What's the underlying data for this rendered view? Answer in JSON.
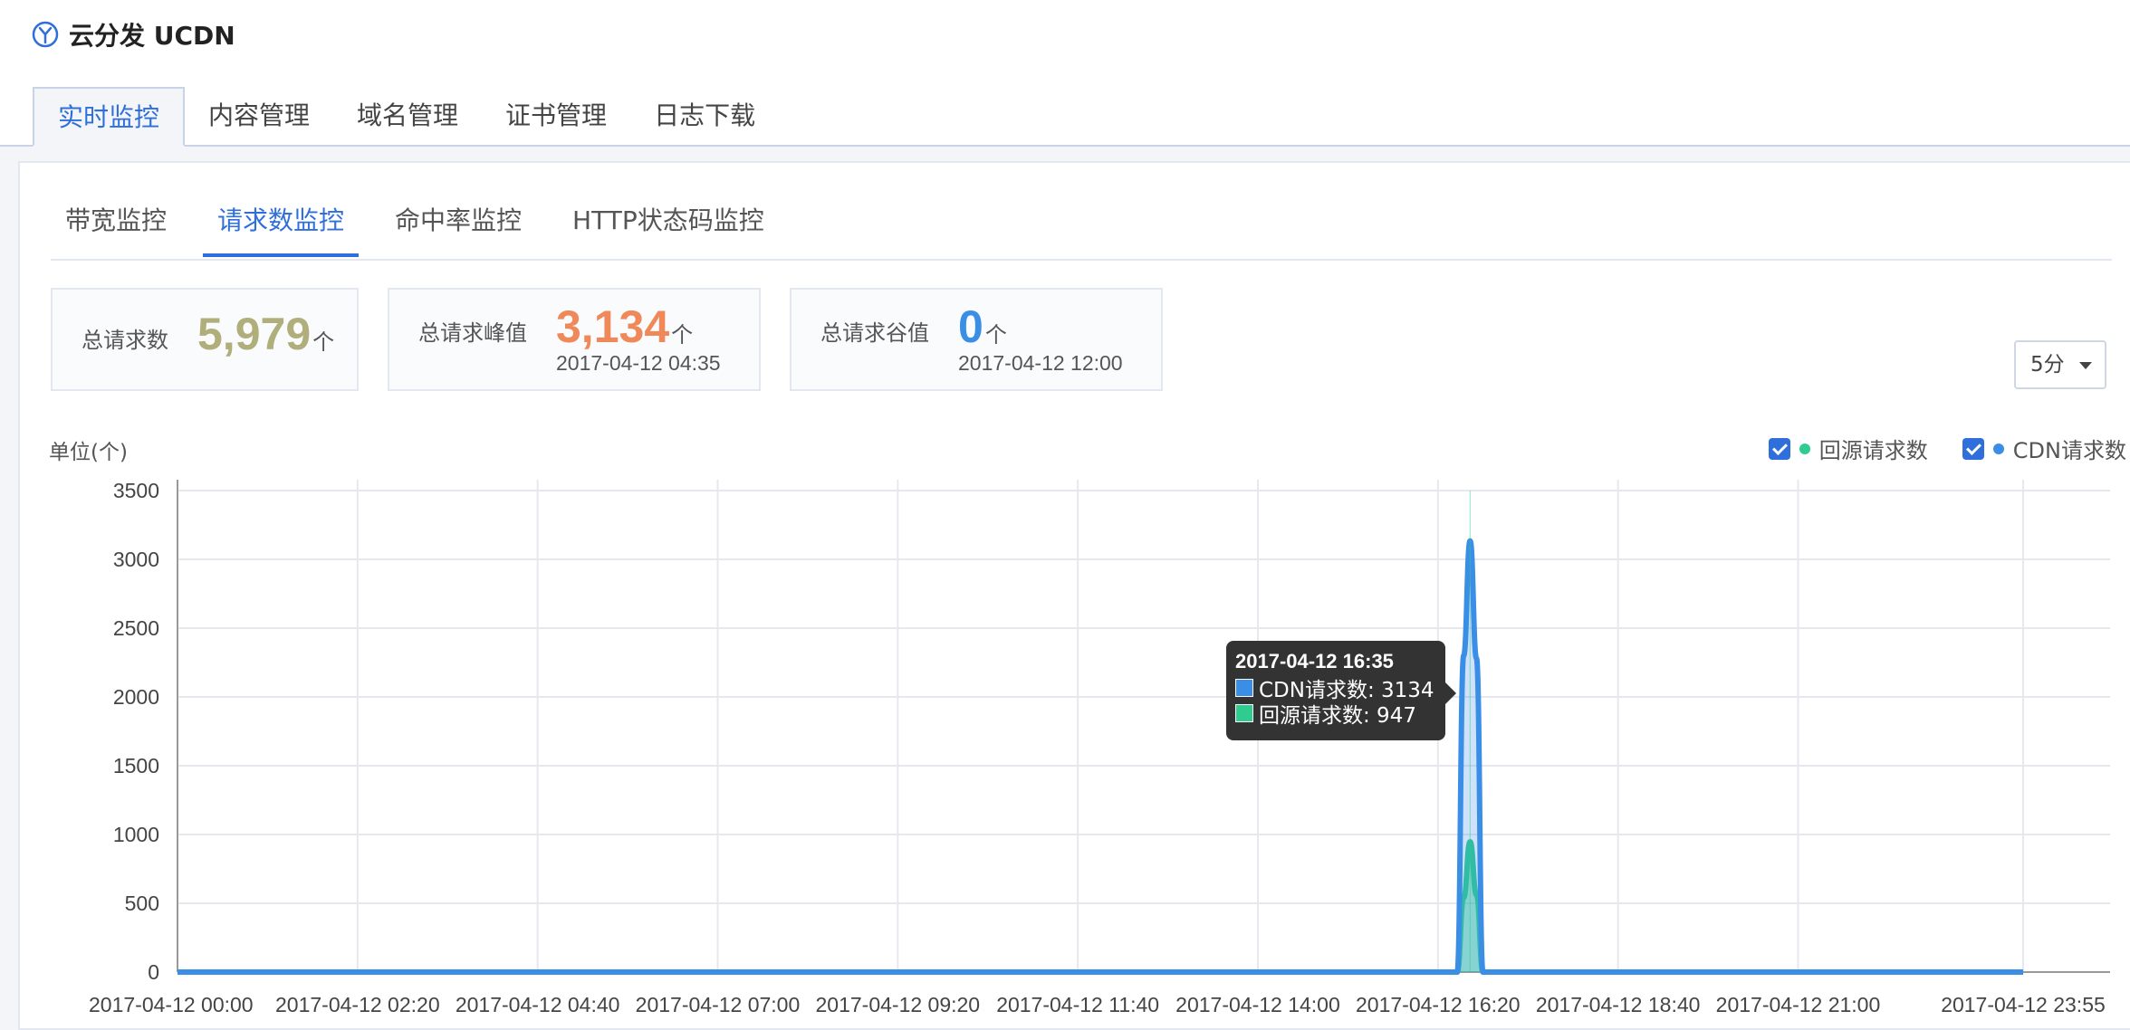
{
  "app": {
    "title": "云分发 UCDN",
    "icon": "ucdn-logo-icon"
  },
  "main_tabs": [
    {
      "label": "实时监控",
      "active": true
    },
    {
      "label": "内容管理",
      "active": false
    },
    {
      "label": "域名管理",
      "active": false
    },
    {
      "label": "证书管理",
      "active": false
    },
    {
      "label": "日志下载",
      "active": false
    }
  ],
  "sub_tabs": [
    {
      "label": "带宽监控",
      "active": false
    },
    {
      "label": "请求数监控",
      "active": true
    },
    {
      "label": "命中率监控",
      "active": false
    },
    {
      "label": "HTTP状态码监控",
      "active": false
    }
  ],
  "stats": {
    "total": {
      "label": "总请求数",
      "value": "5,979",
      "unit": "个",
      "color": "#b0ae7a"
    },
    "peak": {
      "label": "总请求峰值",
      "value": "3,134",
      "unit": "个",
      "time": "2017-04-12 04:35",
      "color": "#f0895a"
    },
    "valley": {
      "label": "总请求谷值",
      "value": "0",
      "unit": "个",
      "time": "2017-04-12 12:00",
      "color": "#3a8ee6"
    }
  },
  "interval": {
    "label": "5分"
  },
  "colors": {
    "accent": "#2f6fdb",
    "cdn_series": "#3a8ee6",
    "origin_series": "#2ecc8f"
  },
  "chart_data": {
    "type": "area",
    "unit_label": "单位(个)",
    "ylim": [
      0,
      3500
    ],
    "y_ticks": [
      "0",
      "500",
      "1000",
      "1500",
      "2000",
      "2500",
      "3000",
      "3500"
    ],
    "x_tick_labels": [
      "2017-04-12 00:00",
      "2017-04-12 02:20",
      "2017-04-12 04:40",
      "2017-04-12 07:00",
      "2017-04-12 09:20",
      "2017-04-12 11:40",
      "2017-04-12 14:00",
      "2017-04-12 16:20",
      "2017-04-12 18:40",
      "2017-04-12 21:00",
      "2017-04-12 23:55"
    ],
    "x_tick_minutes": [
      0,
      140,
      280,
      420,
      560,
      700,
      840,
      980,
      1120,
      1260,
      1435
    ],
    "x_range_minutes": [
      0,
      1435
    ],
    "grid": true,
    "legend_position": "top-right",
    "series": [
      {
        "name": "回源请求数",
        "color": "#2ecc8f",
        "points": [
          [
            0,
            0
          ],
          [
            995,
            0
          ],
          [
            1000,
            540
          ],
          [
            1005,
            947
          ],
          [
            1010,
            560
          ],
          [
            1015,
            0
          ],
          [
            1435,
            0
          ]
        ]
      },
      {
        "name": "CDN请求数",
        "color": "#3a8ee6",
        "points": [
          [
            0,
            0
          ],
          [
            995,
            0
          ],
          [
            1000,
            2300
          ],
          [
            1005,
            3134
          ],
          [
            1010,
            2280
          ],
          [
            1015,
            0
          ],
          [
            1435,
            0
          ]
        ]
      }
    ],
    "tooltip": {
      "title": "2017-04-12 16:35",
      "rows": [
        {
          "label": "CDN请求数: 3134",
          "color": "#3a8ee6"
        },
        {
          "label": "回源请求数: 947",
          "color": "#2ecc8f"
        }
      ]
    }
  }
}
